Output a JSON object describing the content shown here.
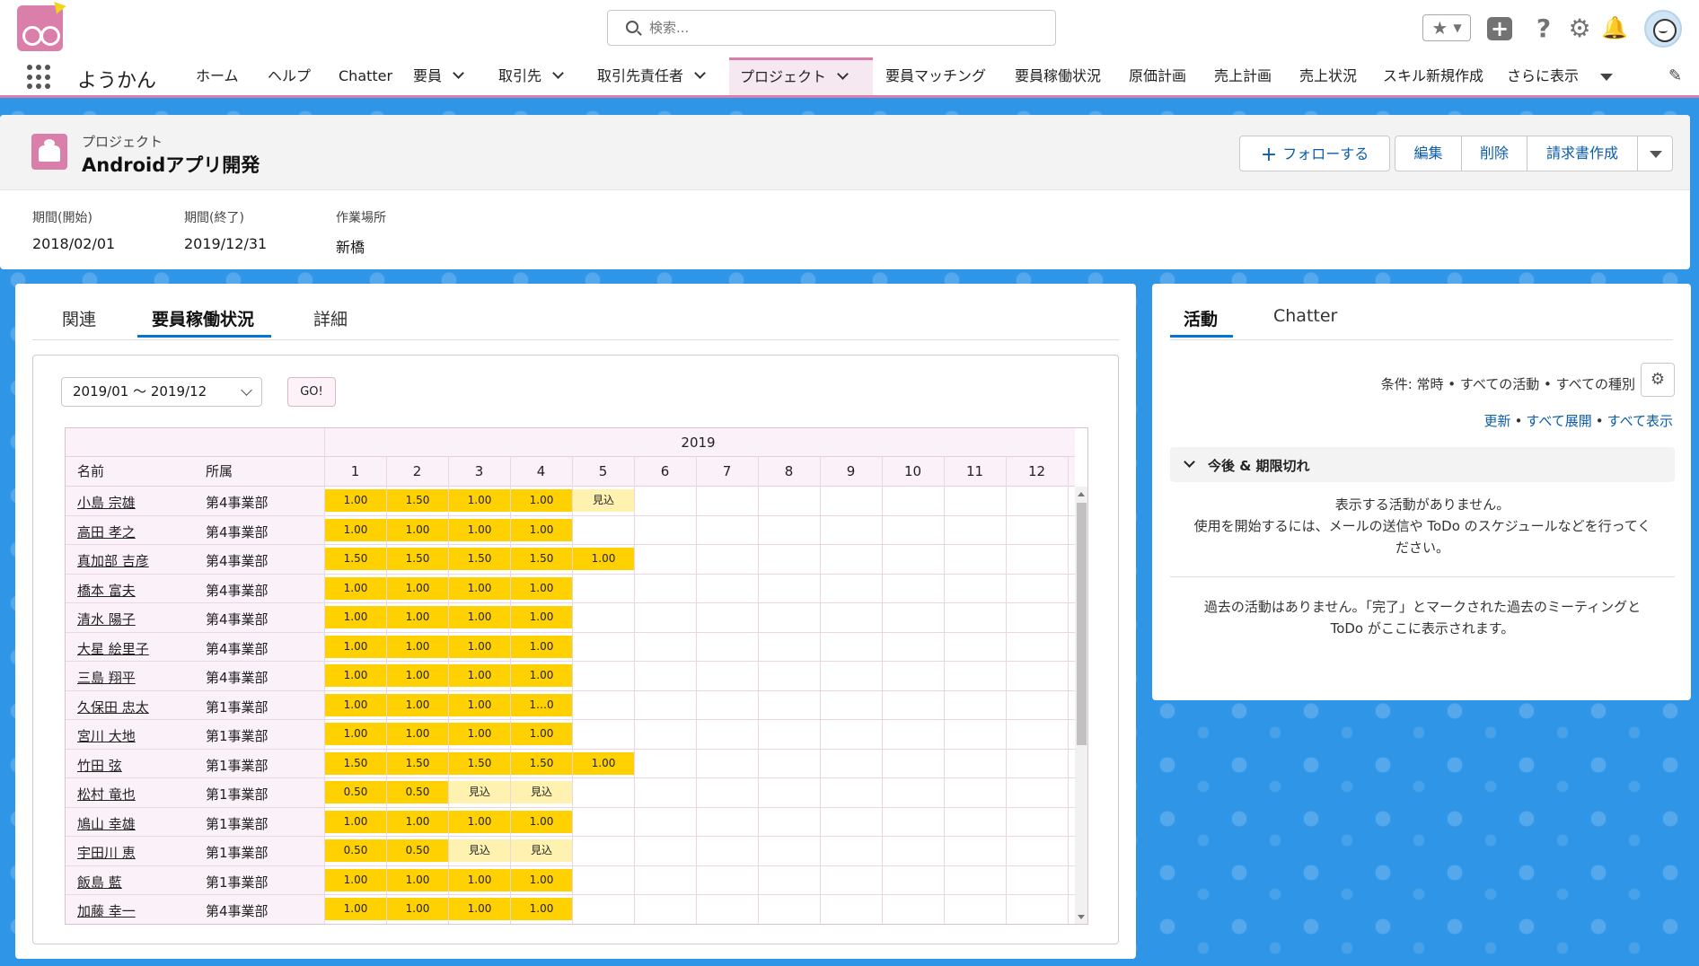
{
  "search": {
    "placeholder": "検索..."
  },
  "app": {
    "name": "ようかん"
  },
  "nav": [
    {
      "label": "ホーム",
      "dropdown": false
    },
    {
      "label": "ヘルプ",
      "dropdown": false
    },
    {
      "label": "Chatter",
      "dropdown": false
    },
    {
      "label": "要員",
      "dropdown": true
    },
    {
      "label": "取引先",
      "dropdown": true
    },
    {
      "label": "取引先責任者",
      "dropdown": true
    },
    {
      "label": "プロジェクト",
      "dropdown": true,
      "active": true
    },
    {
      "label": "要員マッチング",
      "dropdown": false
    },
    {
      "label": "要員稼働状況",
      "dropdown": false
    },
    {
      "label": "原価計画",
      "dropdown": false
    },
    {
      "label": "売上計画",
      "dropdown": false
    },
    {
      "label": "売上状況",
      "dropdown": false
    },
    {
      "label": "スキル新規作成",
      "dropdown": false
    },
    {
      "label": "さらに表示",
      "dropdown": false
    }
  ],
  "record": {
    "object_type": "プロジェクト",
    "title": "Androidアプリ開発",
    "buttons": {
      "follow": "フォローする",
      "edit": "編集",
      "delete": "削除",
      "invoice": "請求書作成"
    },
    "fields": [
      {
        "label": "期間(開始)",
        "value": "2018/02/01"
      },
      {
        "label": "期間(終了)",
        "value": "2019/12/31"
      },
      {
        "label": "作業場所",
        "value": "新橋"
      }
    ]
  },
  "main_tabs": [
    "関連",
    "要員稼働状況",
    "詳細"
  ],
  "utilization": {
    "period": "2019/01 ～ 2019/12",
    "go_label": "GO!",
    "year": "2019",
    "col_name": "名前",
    "col_dept": "所属",
    "months": [
      "1",
      "2",
      "3",
      "4",
      "5",
      "6",
      "7",
      "8",
      "9",
      "10",
      "11",
      "12"
    ],
    "rows": [
      {
        "name": "小島 宗雄",
        "dept": "第4事業部",
        "values": [
          "1.00",
          "1.50",
          "1.00",
          "1.00",
          "見込"
        ],
        "tentative": [
          false,
          false,
          false,
          false,
          true
        ]
      },
      {
        "name": "高田 孝之",
        "dept": "第4事業部",
        "values": [
          "1.00",
          "1.00",
          "1.00",
          "1.00"
        ],
        "tentative": [
          false,
          false,
          false,
          false
        ]
      },
      {
        "name": "真加部 吉彦",
        "dept": "第4事業部",
        "values": [
          "1.50",
          "1.50",
          "1.50",
          "1.50",
          "1.00"
        ],
        "tentative": [
          false,
          false,
          false,
          false,
          false
        ]
      },
      {
        "name": "橋本 富夫",
        "dept": "第4事業部",
        "values": [
          "1.00",
          "1.00",
          "1.00",
          "1.00"
        ],
        "tentative": [
          false,
          false,
          false,
          false
        ]
      },
      {
        "name": "清水 陽子",
        "dept": "第4事業部",
        "values": [
          "1.00",
          "1.00",
          "1.00",
          "1.00"
        ],
        "tentative": [
          false,
          false,
          false,
          false
        ]
      },
      {
        "name": "大星 絵里子",
        "dept": "第4事業部",
        "values": [
          "1.00",
          "1.00",
          "1.00",
          "1.00"
        ],
        "tentative": [
          false,
          false,
          false,
          false
        ]
      },
      {
        "name": "三島 翔平",
        "dept": "第4事業部",
        "values": [
          "1.00",
          "1.00",
          "1.00",
          "1.00"
        ],
        "tentative": [
          false,
          false,
          false,
          false
        ]
      },
      {
        "name": "久保田 忠太",
        "dept": "第1事業部",
        "values": [
          "1.00",
          "1.00",
          "1.00",
          "1…0"
        ],
        "tentative": [
          false,
          false,
          false,
          false
        ]
      },
      {
        "name": "宮川 大地",
        "dept": "第1事業部",
        "values": [
          "1.00",
          "1.00",
          "1.00",
          "1.00"
        ],
        "tentative": [
          false,
          false,
          false,
          false
        ]
      },
      {
        "name": "竹田 弦",
        "dept": "第1事業部",
        "values": [
          "1.50",
          "1.50",
          "1.50",
          "1.50",
          "1.00"
        ],
        "tentative": [
          false,
          false,
          false,
          false,
          false
        ]
      },
      {
        "name": "松村 竜也",
        "dept": "第1事業部",
        "values": [
          "0.50",
          "0.50",
          "見込",
          "見込"
        ],
        "tentative": [
          false,
          false,
          true,
          true
        ]
      },
      {
        "name": "鳩山 幸雄",
        "dept": "第1事業部",
        "values": [
          "1.00",
          "1.00",
          "1.00",
          "1.00"
        ],
        "tentative": [
          false,
          false,
          false,
          false
        ]
      },
      {
        "name": "宇田川 恵",
        "dept": "第1事業部",
        "values": [
          "0.50",
          "0.50",
          "見込",
          "見込"
        ],
        "tentative": [
          false,
          false,
          true,
          true
        ]
      },
      {
        "name": "飯島 藍",
        "dept": "第1事業部",
        "values": [
          "1.00",
          "1.00",
          "1.00",
          "1.00"
        ],
        "tentative": [
          false,
          false,
          false,
          false
        ]
      },
      {
        "name": "加藤 幸一",
        "dept": "第4事業部",
        "values": [
          "1.00",
          "1.00",
          "1.00",
          "1.00"
        ],
        "tentative": [
          false,
          false,
          false,
          false
        ]
      }
    ]
  },
  "activity": {
    "tabs": [
      "活動",
      "Chatter"
    ],
    "condition": "条件: 常時 • すべての活動 • すべての種別",
    "links": [
      "更新",
      "すべて展開",
      "すべて表示"
    ],
    "upcoming_title": "今後 & 期限切れ",
    "no_activity_line1": "表示する活動がありません。",
    "no_activity_line2": "使用を開始するには、メールの送信や ToDo のスケジュールなどを行ってく",
    "no_activity_line3": "ださい。",
    "past_line1": "過去の活動はありません。「完了」とマークされた過去のミーティングと",
    "past_line2": "ToDo がここに表示されます。"
  },
  "colors": {
    "brand_pink": "#d97fa9",
    "fill_yellow": "#ffd100",
    "tentative_yellow": "#fff2b0",
    "background_blue": "#2f95e6",
    "link_blue": "#0b5cab"
  }
}
